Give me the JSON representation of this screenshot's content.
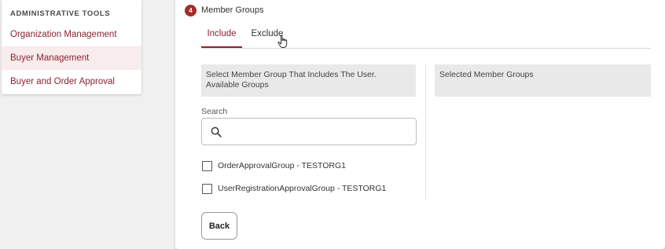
{
  "sidebar": {
    "title": "ADMINISTRATIVE TOOLS",
    "items": [
      {
        "label": "Organization Management",
        "active": false
      },
      {
        "label": "Buyer Management",
        "active": true
      },
      {
        "label": "Buyer and Order Approval",
        "active": false
      }
    ]
  },
  "section": {
    "step_number": "4",
    "title": "Member Groups",
    "tabs": [
      {
        "label": "Include",
        "active": true
      },
      {
        "label": "Exclude",
        "active": false
      }
    ]
  },
  "available": {
    "header_line1": "Select Member Group That Includes The User.",
    "header_line2": "Available Groups",
    "search_label": "Search",
    "search_value": "",
    "search_icon": "search-icon",
    "groups": [
      {
        "label": "OrderApprovalGroup - TESTORG1",
        "checked": false
      },
      {
        "label": "UserRegistrationApprovalGroup - TESTORG1",
        "checked": false
      }
    ]
  },
  "selected": {
    "header": "Selected Member Groups"
  },
  "actions": {
    "back_label": "Back"
  },
  "colors": {
    "accent": "#8b2332",
    "badge": "#a62a2a",
    "sidebar_active_bg": "#f8ecec",
    "header_bg": "#e9e9e9"
  }
}
